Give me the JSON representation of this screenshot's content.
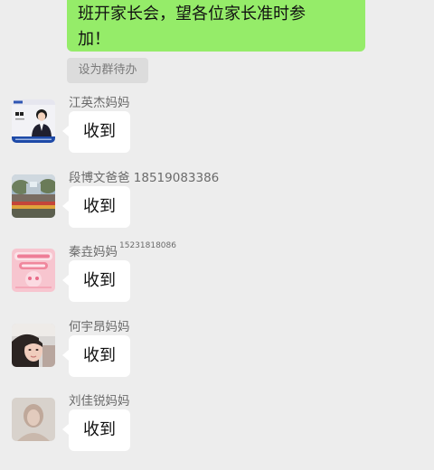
{
  "top_message": {
    "line1": "班开家长会，望各位家长准时参",
    "line2": "加！"
  },
  "set_todo_label": "设为群待办",
  "messages": [
    {
      "sender": "江英杰妈妈",
      "sender_phone": "",
      "text": "收到",
      "avatar": "id-card-portrait"
    },
    {
      "sender": "段博文爸爸 18519083386",
      "sender_phone": "",
      "text": "收到",
      "avatar": "fountain-photo"
    },
    {
      "sender": "秦垚妈妈",
      "sender_phone": "15231818086",
      "text": "收到",
      "avatar": "pink-graphic"
    },
    {
      "sender": "何宇昂妈妈",
      "sender_phone": "",
      "text": "收到",
      "avatar": "selfie-photo"
    },
    {
      "sender": "刘佳锐妈妈",
      "sender_phone": "",
      "text": "收到",
      "avatar": "blurred-photo"
    }
  ],
  "colors": {
    "background": "#ededed",
    "sent_bubble": "#95ec69",
    "received_bubble": "#ffffff",
    "todo_button": "#dcdcdc"
  }
}
